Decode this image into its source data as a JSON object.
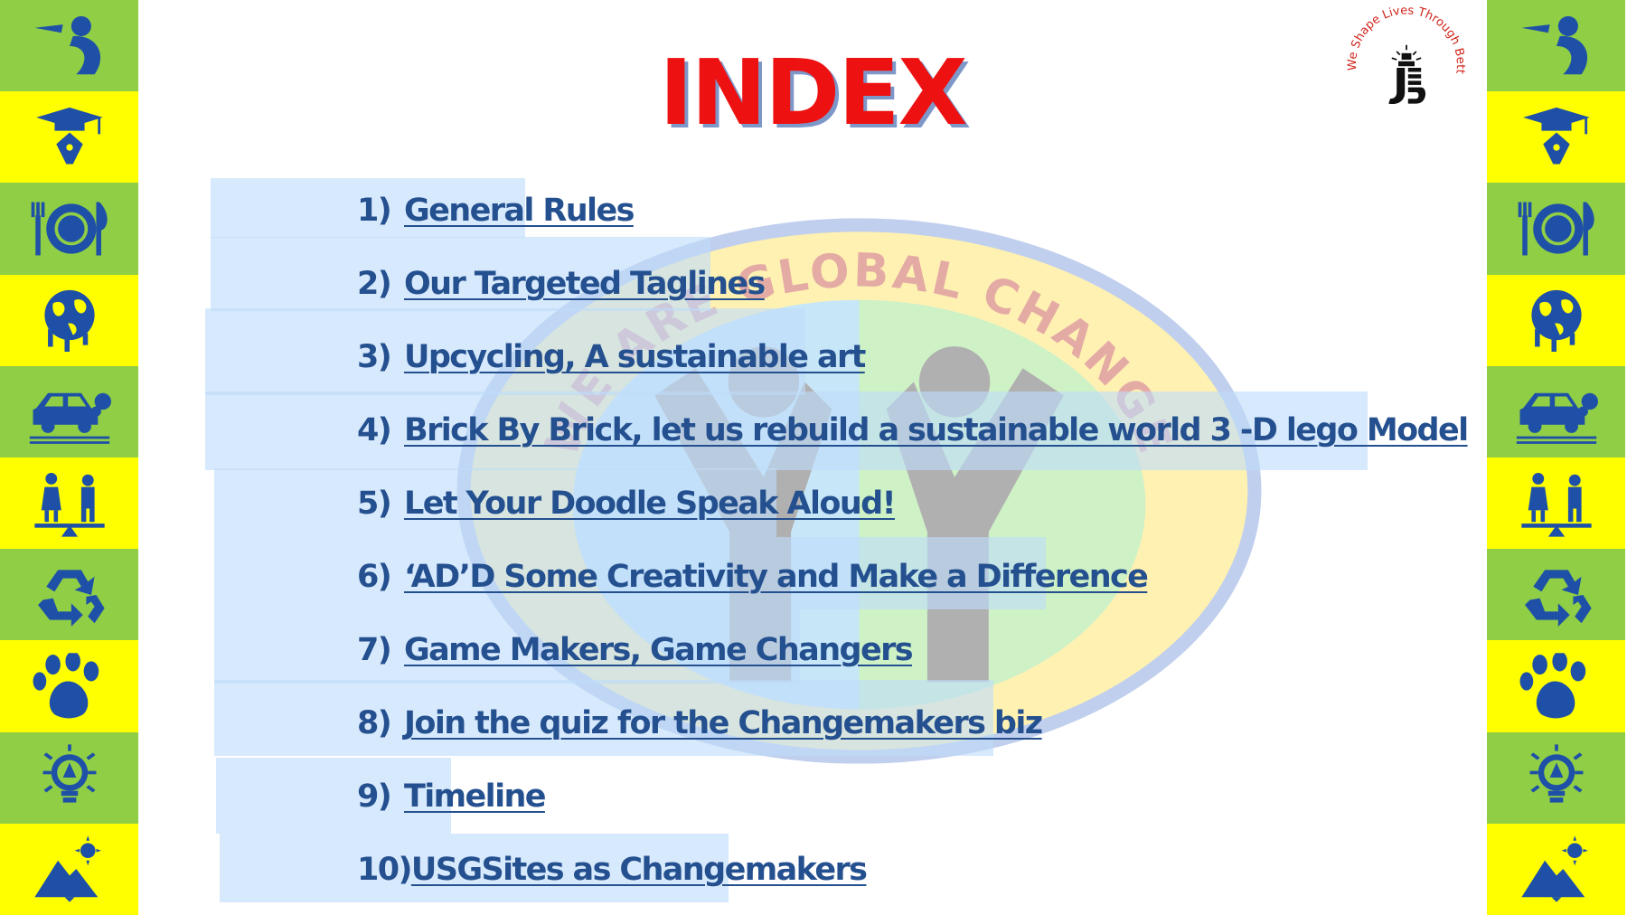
{
  "title": "INDEX",
  "logo": {
    "icon": "jds-school-logo-icon",
    "motto": "We Shape Lives Through Better Education"
  },
  "watermark": {
    "icon": "global-changemakers-emblem-icon",
    "text": "WE ARE GLOBAL CHANGE MAKERS"
  },
  "side_icons": [
    "praying-person-icon",
    "graduation-pen-icon",
    "plate-cutlery-icon",
    "melting-globe-icon",
    "car-pollution-icon",
    "gender-equality-icon",
    "recycle-icon",
    "paw-print-icon",
    "lightbulb-icon",
    "mountain-sun-icon"
  ],
  "colors": {
    "title": "#ee1111",
    "link": "#24508f",
    "strip_green": "#8fce45",
    "strip_yellow": "#ffff00",
    "icon_blue": "#1f50a8"
  },
  "items": [
    {
      "number": "1)",
      "label": "General Rules"
    },
    {
      "number": "2)",
      "label": "Our Targeted Taglines"
    },
    {
      "number": "3)",
      "label": "Upcycling, A sustainable art"
    },
    {
      "number": "4)",
      "label": "Brick By Brick, let us rebuild a sustainable world 3 -D lego Model"
    },
    {
      "number": "5)",
      "label": "Let Your Doodle Speak Aloud!"
    },
    {
      "number": "6)",
      "label": "‘AD’D Some Creativity and Make a Difference"
    },
    {
      "number": "7)",
      "label": "Game Makers, Game Changers"
    },
    {
      "number": "8)",
      "label": "Join the quiz for the Changemakers biz"
    },
    {
      "number": "9)",
      "label": "Timeline"
    },
    {
      "number": "10)",
      "label": "USGSites as Changemakers"
    }
  ]
}
